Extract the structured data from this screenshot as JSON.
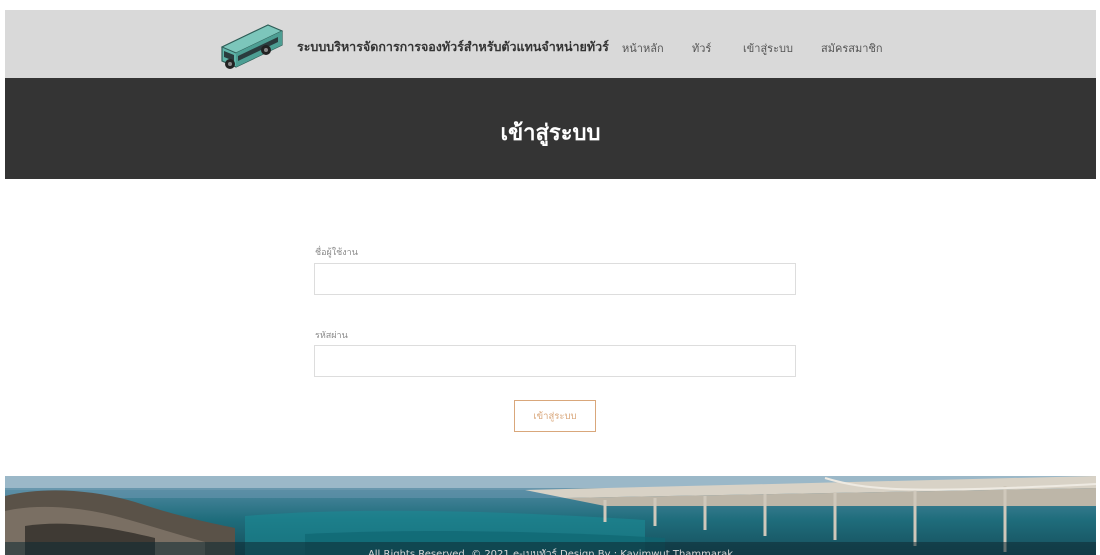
{
  "header": {
    "logo_icon": "bus-icon",
    "brand": "ระบบบริหารจัดการการจองทัวร์สำหรับตัวแทนจำหน่ายทัวร์",
    "nav": [
      "หน้าหลัก",
      "ทัวร์",
      "เข้าสู่ระบบ",
      "สมัครสมาชิก"
    ]
  },
  "page_title": "เข้าสู่ระบบ",
  "form": {
    "username_label": "ชื่อผู้ใช้งาน",
    "username_value": "",
    "password_label": "รหัสผ่าน",
    "password_value": "",
    "submit_label": "เข้าสู่ระบบ"
  },
  "footer": {
    "copyright": "All Rights Reserved. © 2021 e-เบนทัวร์ Design By : Kavimwut Thammarak"
  },
  "colors": {
    "header_bg": "#d9d9d9",
    "title_band_bg": "#343434",
    "accent": "#d9a77b",
    "bus": "#5fb3a8"
  }
}
